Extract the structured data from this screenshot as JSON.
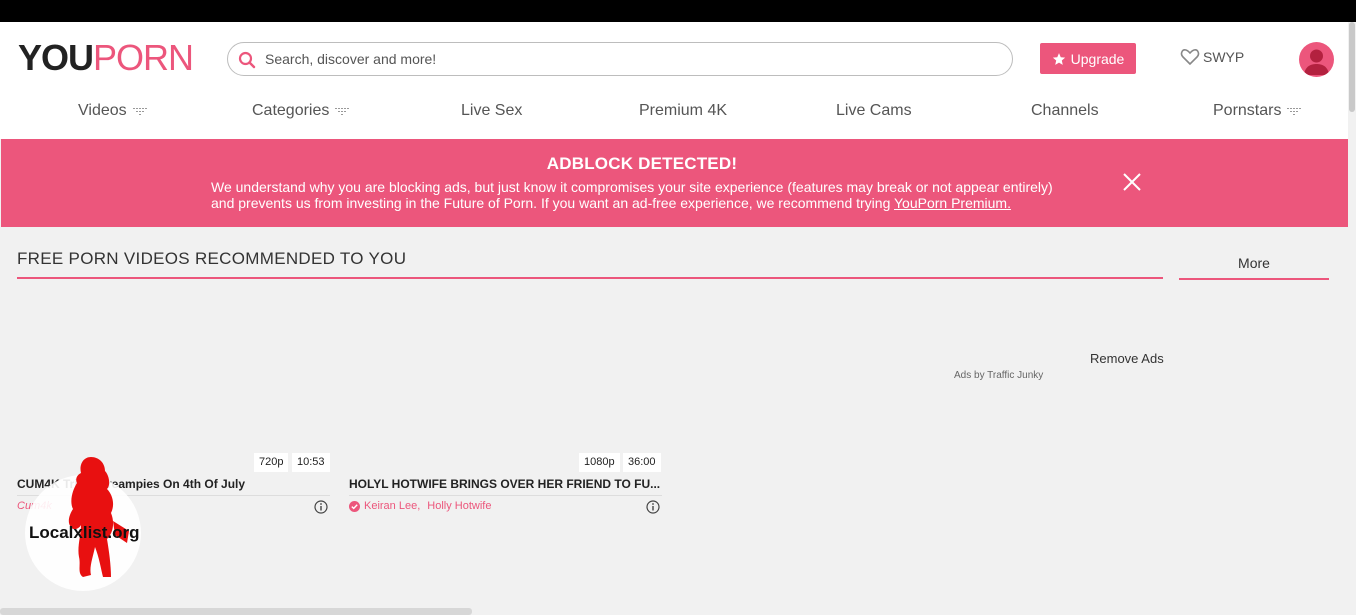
{
  "header": {
    "logo_you": "YOU",
    "logo_porn": "PORN",
    "search_placeholder": "Search, discover and more!",
    "upgrade_label": "Upgrade",
    "swyp_label": "SWYP"
  },
  "nav": {
    "items": [
      {
        "label": "Videos",
        "dropdown": true
      },
      {
        "label": "Categories",
        "dropdown": true
      },
      {
        "label": "Live Sex",
        "dropdown": false
      },
      {
        "label": "Premium 4K",
        "dropdown": false
      },
      {
        "label": "Live Cams",
        "dropdown": false
      },
      {
        "label": "Channels",
        "dropdown": false
      },
      {
        "label": "Pornstars",
        "dropdown": true
      }
    ]
  },
  "banner": {
    "title": "ADBLOCK DETECTED!",
    "line1": "We understand why you are blocking ads, but just know it compromises your site experience (features may break or not appear entirely)",
    "line2": "and prevents us from investing in the Future of Porn. If you want an ad-free experience, we recommend trying",
    "link": "YouPorn Premium."
  },
  "section": {
    "title": "FREE PORN VIDEOS RECOMMENDED TO YOU",
    "more_label": "More",
    "remove_ads": "Remove Ads",
    "ads_by": "Ads by Traffic Junky"
  },
  "videos": [
    {
      "resolution": "720p",
      "duration": "10:53",
      "title": "CUM4K Triple Creampies On 4th Of July",
      "meta": "Cum4k"
    },
    {
      "resolution": "1080p",
      "duration": "36:00",
      "title": "HOLYL HOTWIFE BRINGS OVER HER FRIEND TO FU...",
      "performers": [
        "Keiran Lee,",
        "Holly Hotwife"
      ]
    }
  ],
  "watermark": "Localxlist.org",
  "colors": {
    "accent": "#ec567c",
    "topbar": "#000000"
  }
}
